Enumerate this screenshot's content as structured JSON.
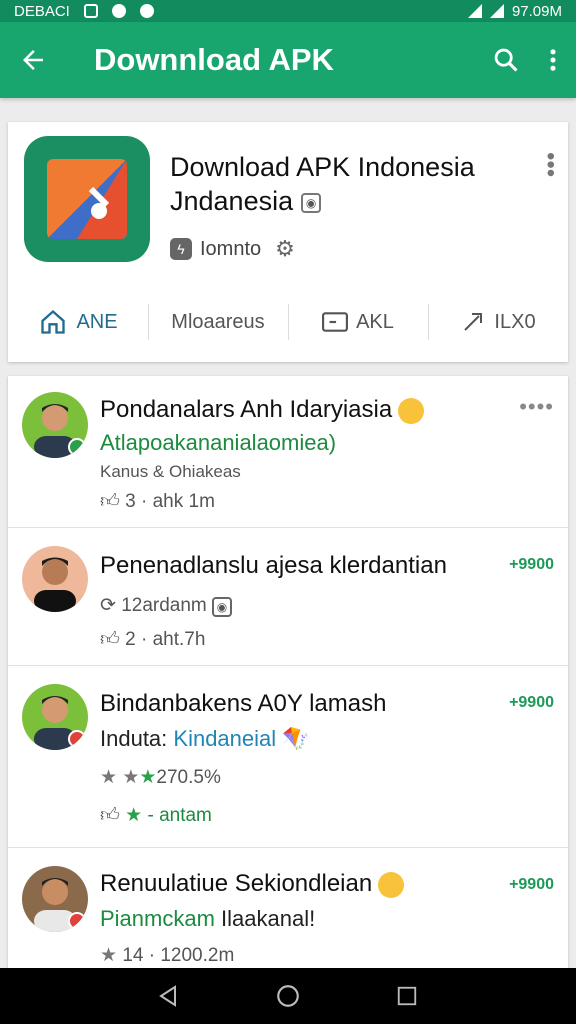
{
  "status_bar": {
    "left_text": "DEBACI",
    "right_text": "97.09M"
  },
  "app_bar": {
    "title": "Downnload APK"
  },
  "app_card": {
    "title": "Download APK Indonesia Jndanesia",
    "developer": "Iomnto",
    "tabs": [
      {
        "label": "ANE",
        "icon": "home-icon"
      },
      {
        "label": "Mloaareus",
        "icon": ""
      },
      {
        "label": "AKL",
        "icon": "window-icon"
      },
      {
        "label": "ILX0",
        "icon": "share-icon"
      }
    ]
  },
  "posts": [
    {
      "title": "Pondanalars Anh Idaryiasia",
      "subtitle": "Atlapoakananialaomiea)",
      "meta": "Kanus & Ohiakeas",
      "stats": "3 · ahk 1m",
      "price": "",
      "badge_color": "#2aa04a"
    },
    {
      "title": "Penenadlanslu ajesa klerdantian",
      "subtitle": "",
      "meta": "12ardanm",
      "stats": "2 · aht.7h",
      "price": "+9900",
      "badge_color": ""
    },
    {
      "title": "Bindanbakens A0Y lamash",
      "subtitle_prefix": "Indutа: ",
      "subtitle_highlight": "Kindaneial",
      "meta": "270.5%",
      "stats": "- antam",
      "price": "+9900",
      "badge_color": "#e0413a"
    },
    {
      "title": "Renuulatiue Sekiondleian",
      "subtitle_prefix": "Pianmckam ",
      "subtitle_highlight": "Ilaakanal!",
      "meta": "14 · 1200.2m",
      "stats": "",
      "price": "+9900",
      "badge_color": "#e0413a"
    }
  ],
  "colors": {
    "appbar": "#18a56e",
    "statusbar": "#128c5e",
    "price": "#1c9a57",
    "accent_tab": "#1f6c8f"
  }
}
